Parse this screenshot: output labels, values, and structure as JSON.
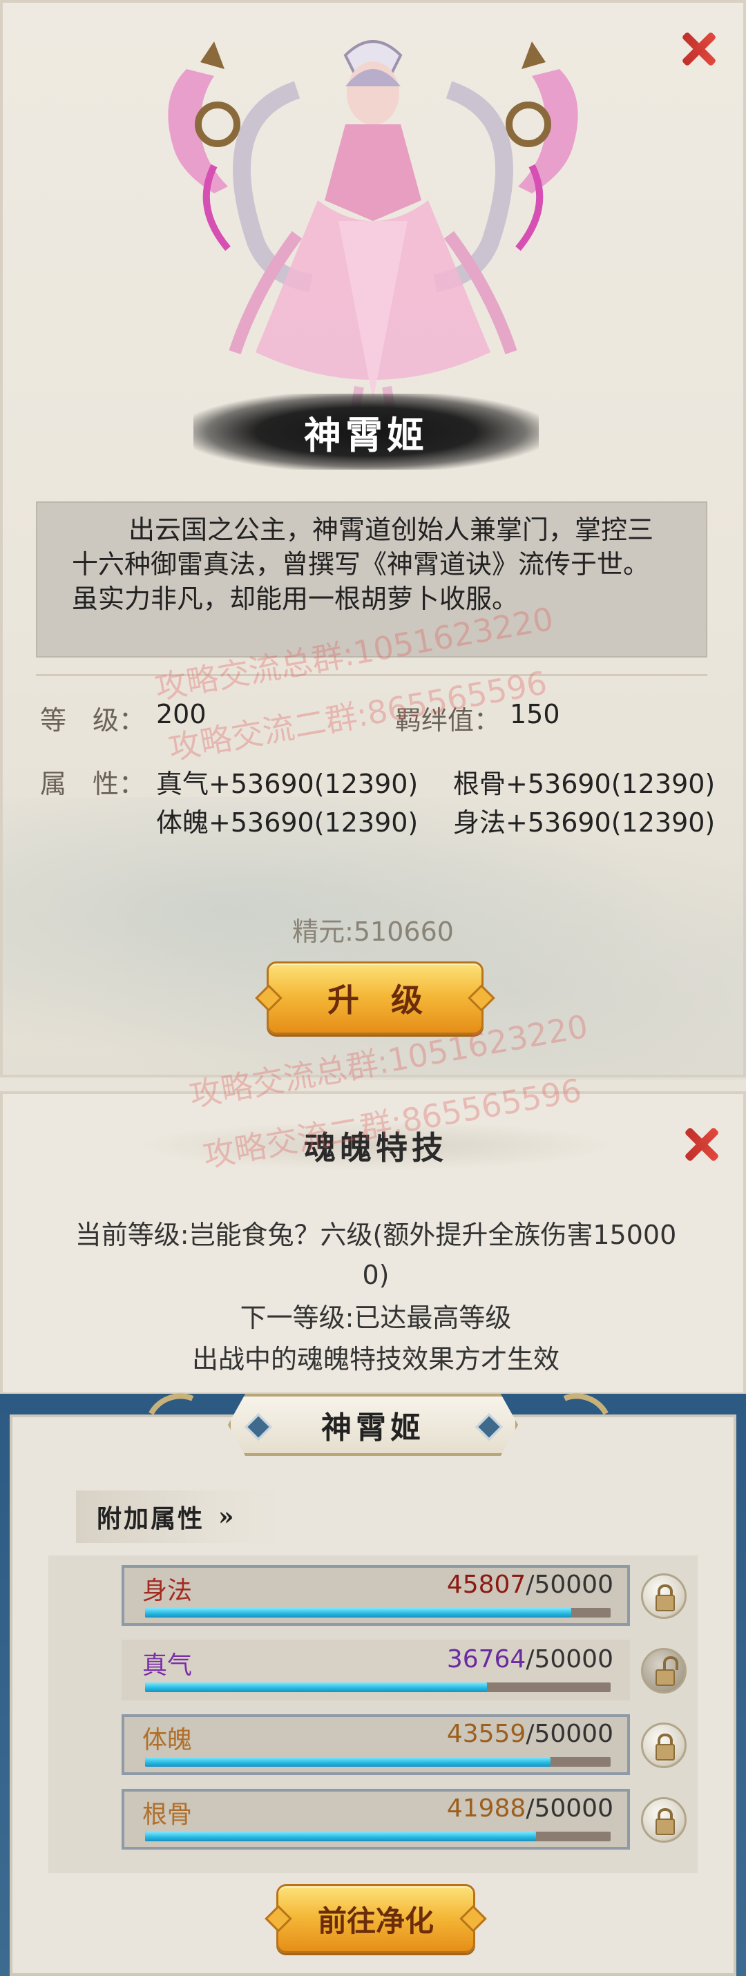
{
  "hero": {
    "name": "神霄姬",
    "description": "出云国之公主，神霄道创始人兼掌门，掌控三十六种御雷真法，曾撰写《神霄道诀》流传于世。虽实力非凡，却能用一根胡萝卜收服。",
    "level_label": "等　级：",
    "level_value": "200",
    "bond_label": "羁绊值：",
    "bond_value": "150",
    "attr_label": "属　性：",
    "attrs": [
      "真气+53690(12390)",
      "根骨+53690(12390)",
      "体魄+53690(12390)",
      "身法+53690(12390)"
    ],
    "essence": "精元:510660",
    "upgrade_label": "升　级"
  },
  "skill": {
    "title": "魂魄特技",
    "current_line1": "当前等级:岂能食兔？六级(额外提升全族伤害15000",
    "current_line2": "0)",
    "next": "下一等级:已达最高等级",
    "note": "出战中的魂魄特技效果方才生效"
  },
  "bonus": {
    "header_name": "神霄姬",
    "section_title": "附加属性",
    "rows": [
      {
        "name": "身法",
        "value": "45807",
        "max": "/50000",
        "name_color": "#a52a1f",
        "value_color": "#8b1a12",
        "fill": 0.916,
        "locked": true
      },
      {
        "name": "真气",
        "value": "36764",
        "max": "/50000",
        "name_color": "#7a2fa8",
        "value_color": "#6a2aa0",
        "fill": 0.735,
        "locked": false
      },
      {
        "name": "体魄",
        "value": "43559",
        "max": "/50000",
        "name_color": "#b0702a",
        "value_color": "#9c5f1e",
        "fill": 0.871,
        "locked": true
      },
      {
        "name": "根骨",
        "value": "41988",
        "max": "/50000",
        "name_color": "#b0702a",
        "value_color": "#9c5f1e",
        "fill": 0.84,
        "locked": true
      }
    ],
    "purify_label": "前往净化"
  },
  "watermarks": [
    "攻略交流总群:1051623220",
    "攻略交流二群:865565596",
    "攻略交流总群:1051623220",
    "攻略交流二群:865565596"
  ],
  "icons": [
    "close-icon",
    "lock-icon",
    "unlock-icon",
    "chevron-right-icon",
    "diamond-ornament-icon"
  ]
}
